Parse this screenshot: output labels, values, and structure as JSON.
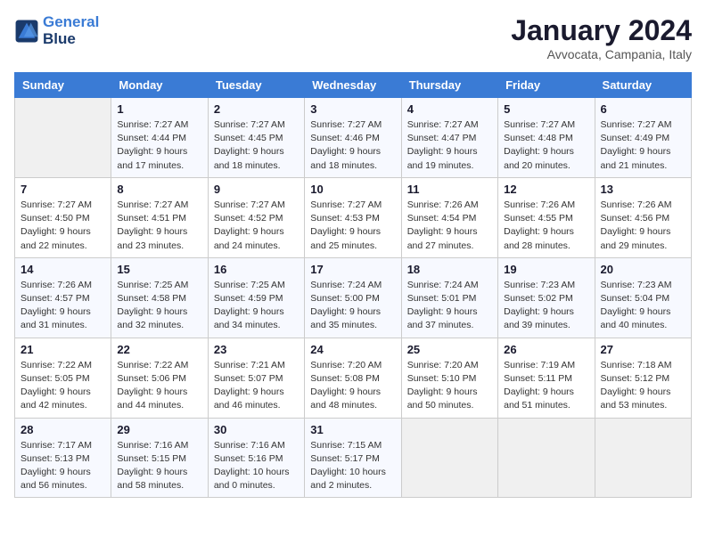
{
  "logo": {
    "line1": "General",
    "line2": "Blue"
  },
  "title": "January 2024",
  "subtitle": "Avvocata, Campania, Italy",
  "header_days": [
    "Sunday",
    "Monday",
    "Tuesday",
    "Wednesday",
    "Thursday",
    "Friday",
    "Saturday"
  ],
  "weeks": [
    [
      {
        "day": "",
        "info": ""
      },
      {
        "day": "1",
        "info": "Sunrise: 7:27 AM\nSunset: 4:44 PM\nDaylight: 9 hours\nand 17 minutes."
      },
      {
        "day": "2",
        "info": "Sunrise: 7:27 AM\nSunset: 4:45 PM\nDaylight: 9 hours\nand 18 minutes."
      },
      {
        "day": "3",
        "info": "Sunrise: 7:27 AM\nSunset: 4:46 PM\nDaylight: 9 hours\nand 18 minutes."
      },
      {
        "day": "4",
        "info": "Sunrise: 7:27 AM\nSunset: 4:47 PM\nDaylight: 9 hours\nand 19 minutes."
      },
      {
        "day": "5",
        "info": "Sunrise: 7:27 AM\nSunset: 4:48 PM\nDaylight: 9 hours\nand 20 minutes."
      },
      {
        "day": "6",
        "info": "Sunrise: 7:27 AM\nSunset: 4:49 PM\nDaylight: 9 hours\nand 21 minutes."
      }
    ],
    [
      {
        "day": "7",
        "info": "Sunrise: 7:27 AM\nSunset: 4:50 PM\nDaylight: 9 hours\nand 22 minutes."
      },
      {
        "day": "8",
        "info": "Sunrise: 7:27 AM\nSunset: 4:51 PM\nDaylight: 9 hours\nand 23 minutes."
      },
      {
        "day": "9",
        "info": "Sunrise: 7:27 AM\nSunset: 4:52 PM\nDaylight: 9 hours\nand 24 minutes."
      },
      {
        "day": "10",
        "info": "Sunrise: 7:27 AM\nSunset: 4:53 PM\nDaylight: 9 hours\nand 25 minutes."
      },
      {
        "day": "11",
        "info": "Sunrise: 7:26 AM\nSunset: 4:54 PM\nDaylight: 9 hours\nand 27 minutes."
      },
      {
        "day": "12",
        "info": "Sunrise: 7:26 AM\nSunset: 4:55 PM\nDaylight: 9 hours\nand 28 minutes."
      },
      {
        "day": "13",
        "info": "Sunrise: 7:26 AM\nSunset: 4:56 PM\nDaylight: 9 hours\nand 29 minutes."
      }
    ],
    [
      {
        "day": "14",
        "info": "Sunrise: 7:26 AM\nSunset: 4:57 PM\nDaylight: 9 hours\nand 31 minutes."
      },
      {
        "day": "15",
        "info": "Sunrise: 7:25 AM\nSunset: 4:58 PM\nDaylight: 9 hours\nand 32 minutes."
      },
      {
        "day": "16",
        "info": "Sunrise: 7:25 AM\nSunset: 4:59 PM\nDaylight: 9 hours\nand 34 minutes."
      },
      {
        "day": "17",
        "info": "Sunrise: 7:24 AM\nSunset: 5:00 PM\nDaylight: 9 hours\nand 35 minutes."
      },
      {
        "day": "18",
        "info": "Sunrise: 7:24 AM\nSunset: 5:01 PM\nDaylight: 9 hours\nand 37 minutes."
      },
      {
        "day": "19",
        "info": "Sunrise: 7:23 AM\nSunset: 5:02 PM\nDaylight: 9 hours\nand 39 minutes."
      },
      {
        "day": "20",
        "info": "Sunrise: 7:23 AM\nSunset: 5:04 PM\nDaylight: 9 hours\nand 40 minutes."
      }
    ],
    [
      {
        "day": "21",
        "info": "Sunrise: 7:22 AM\nSunset: 5:05 PM\nDaylight: 9 hours\nand 42 minutes."
      },
      {
        "day": "22",
        "info": "Sunrise: 7:22 AM\nSunset: 5:06 PM\nDaylight: 9 hours\nand 44 minutes."
      },
      {
        "day": "23",
        "info": "Sunrise: 7:21 AM\nSunset: 5:07 PM\nDaylight: 9 hours\nand 46 minutes."
      },
      {
        "day": "24",
        "info": "Sunrise: 7:20 AM\nSunset: 5:08 PM\nDaylight: 9 hours\nand 48 minutes."
      },
      {
        "day": "25",
        "info": "Sunrise: 7:20 AM\nSunset: 5:10 PM\nDaylight: 9 hours\nand 50 minutes."
      },
      {
        "day": "26",
        "info": "Sunrise: 7:19 AM\nSunset: 5:11 PM\nDaylight: 9 hours\nand 51 minutes."
      },
      {
        "day": "27",
        "info": "Sunrise: 7:18 AM\nSunset: 5:12 PM\nDaylight: 9 hours\nand 53 minutes."
      }
    ],
    [
      {
        "day": "28",
        "info": "Sunrise: 7:17 AM\nSunset: 5:13 PM\nDaylight: 9 hours\nand 56 minutes."
      },
      {
        "day": "29",
        "info": "Sunrise: 7:16 AM\nSunset: 5:15 PM\nDaylight: 9 hours\nand 58 minutes."
      },
      {
        "day": "30",
        "info": "Sunrise: 7:16 AM\nSunset: 5:16 PM\nDaylight: 10 hours\nand 0 minutes."
      },
      {
        "day": "31",
        "info": "Sunrise: 7:15 AM\nSunset: 5:17 PM\nDaylight: 10 hours\nand 2 minutes."
      },
      {
        "day": "",
        "info": ""
      },
      {
        "day": "",
        "info": ""
      },
      {
        "day": "",
        "info": ""
      }
    ]
  ]
}
